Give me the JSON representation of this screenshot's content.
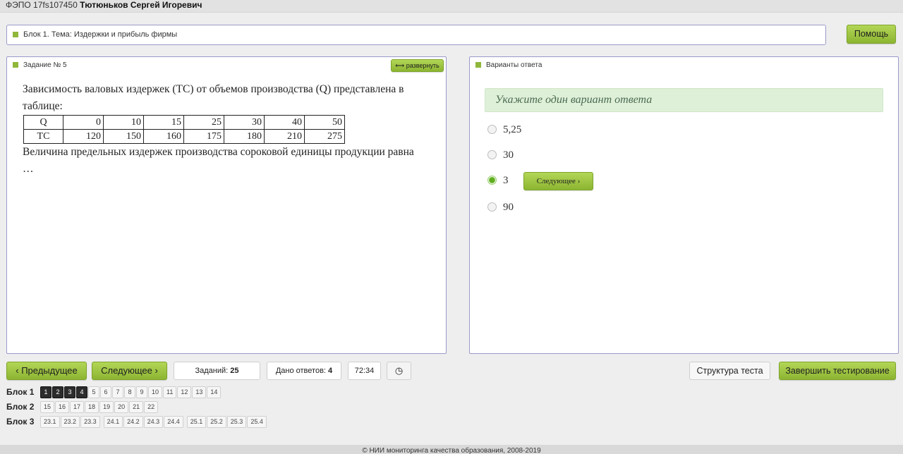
{
  "header": {
    "code": "ФЭПО 17fs107450",
    "user_name": "Тютюньков Сергей Игоревич"
  },
  "block_bar": {
    "text": "Блок 1. Тема: Издержки и прибыль фирмы"
  },
  "help_button": "Помощь",
  "task": {
    "title": "Задание № 5",
    "expand_label": "развернуть",
    "text_before": "Зависимость валовых издержек (ТС) от объемов производства (Q) представлена в таблице:",
    "table": {
      "rows": [
        {
          "header": "Q",
          "values": [
            "0",
            "10",
            "15",
            "25",
            "30",
            "40",
            "50"
          ]
        },
        {
          "header": "TC",
          "values": [
            "120",
            "150",
            "160",
            "175",
            "180",
            "210",
            "275"
          ]
        }
      ]
    },
    "text_after": "Величина предельных издержек производства сороковой единицы продукции равна …"
  },
  "answers": {
    "title": "Варианты ответа",
    "hint": "Укажите один вариант ответа",
    "options": [
      {
        "label": "5,25",
        "selected": false
      },
      {
        "label": "30",
        "selected": false
      },
      {
        "label": "3",
        "selected": true
      },
      {
        "label": "90",
        "selected": false
      }
    ],
    "next_inline_label": "Следующее"
  },
  "nav": {
    "prev_label": "Предыдущее",
    "next_label": "Следующее",
    "tasks_label": "Заданий:",
    "tasks_count": "25",
    "answered_label": "Дано ответов:",
    "answered_count": "4",
    "timer": "72:34",
    "structure_label": "Структура теста",
    "finish_label": "Завершить тестирование"
  },
  "pager": {
    "blocks": [
      {
        "label": "Блок 1",
        "groups": [
          [
            "1",
            "2",
            "3",
            "4",
            "5",
            "6",
            "7",
            "8",
            "9",
            "10",
            "11",
            "12",
            "13",
            "14"
          ]
        ],
        "done": [
          "1",
          "2",
          "3",
          "4"
        ]
      },
      {
        "label": "Блок 2",
        "groups": [
          [
            "15",
            "16",
            "17",
            "18",
            "19",
            "20",
            "21",
            "22"
          ]
        ],
        "done": []
      },
      {
        "label": "Блок 3",
        "groups": [
          [
            "23.1",
            "23.2",
            "23.3"
          ],
          [
            "24.1",
            "24.2",
            "24.3",
            "24.4"
          ],
          [
            "25.1",
            "25.2",
            "25.3",
            "25.4"
          ]
        ],
        "done": []
      }
    ]
  },
  "footer": "© НИИ мониторинга качества образования, 2008-2019",
  "colors": {
    "accent_green": "#8fb73a",
    "panel_border": "#9a9acb",
    "hint_bg": "#dff0d8",
    "done_page": "#2c2c2c"
  }
}
